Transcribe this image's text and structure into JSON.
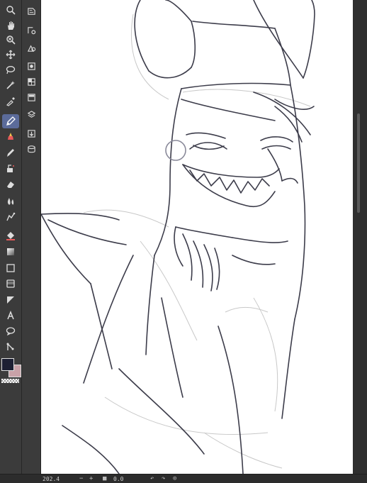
{
  "status_bar": {
    "zoom": "202.4",
    "zoom_minus": "−",
    "zoom_plus": "+",
    "angle": "0.0"
  },
  "colors": {
    "main_color": "#1d2033",
    "sub_color": "#c9a2a8",
    "active_tool_highlight": "#5b6b9a"
  },
  "tools_left": [
    "zoom-icon",
    "hand-icon",
    "rotate-icon",
    "move-icon",
    "lasso-select-icon",
    "magic-wand-icon",
    "eyedropper-icon",
    "pen-icon",
    "pencil-icon",
    "brush-icon",
    "airbrush-icon",
    "eraser-icon",
    "blend-icon",
    "figure-icon",
    "fill-icon",
    "gradient-icon",
    "frame-icon",
    "ruler-icon",
    "vector-line-icon",
    "text-icon",
    "balloon-icon",
    "correct-line-icon"
  ],
  "tools_second": [
    "layer-property-icon",
    "layer-settings-icon",
    "color-layer-icon",
    "tone-icon",
    "layer-grid-icon",
    "layer-list-icon",
    "layers-icon",
    "export-icon",
    "database-icon"
  ]
}
